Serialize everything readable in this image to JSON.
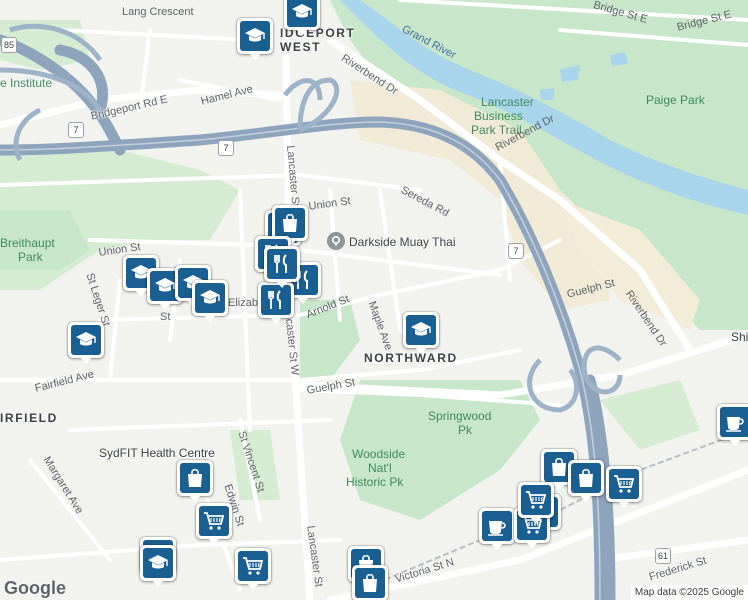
{
  "map": {
    "attribution": "Map data ©2025 Google",
    "logo": "Google",
    "colors": {
      "background": "#f2f2ee",
      "park": "#c8e6c9",
      "water": "#a8d4ec",
      "highway": "#8ea4bd",
      "road": "#ffffff",
      "sand": "#f1ead7",
      "poi_marker": "#1a5f91"
    }
  },
  "labels": {
    "lang_crescent": "Lang Crescent",
    "bridgeport_west_a": "IDGEPORT",
    "bridgeport_west_b": "WEST",
    "institute": "e Institute",
    "bridgeport_rd_e": "Bridgeport Rd E",
    "hamel_ave": "Hamel Ave",
    "riverbend_dr_1": "Riverbend Dr",
    "grand_river": "Grand River",
    "bridge_st_e_1": "Bridge St E",
    "bridge_st_e_2": "Bridge St E",
    "paige_park": "Paige Park",
    "lancaster_park_a": "Lancaster",
    "lancaster_park_b": "Business",
    "lancaster_park_c": "Park Trail",
    "riverbend_dr_2": "Riverbend Dr",
    "riverbend_dr_3": "Riverbend Dr",
    "lancaster_st_w_1": "Lancaster St W",
    "union_st_1": "Union St",
    "sereda_rd": "Sereda Rd",
    "darkside": "Darkside Muay Thai",
    "breithaupt_a": "Breithaupt",
    "breithaupt_b": "Park",
    "union_st_2": "Union St",
    "st_leger": "St Leger St",
    "elizabeth": "Elizabeth",
    "arnold_st": "Arnold St",
    "maple_ave": "Maple Ave",
    "lancaster_st_w_2": "Lancaster St W",
    "guelph_st_1": "Guelph St",
    "northward": "NORTHWARD",
    "shirley": "Shi",
    "fairfield_ave": "Fairfield Ave",
    "fairfield": "IRFIELD",
    "guelph_st_2": "Guelph St",
    "springwood_a": "Springwood",
    "springwood_b": "Pk",
    "sydfit": "SydFIT Health Centre",
    "woodside_a": "Woodside",
    "woodside_b": "Nat'l",
    "woodside_c": "Historic Pk",
    "st_vincent": "St Vincent St",
    "margaret_ave": "Margaret Ave",
    "edwin_st": "Edwin St",
    "lancaster_st_3": "Lancaster St",
    "victoria_st_n": "Victoria St N",
    "frederick_st": "Frederick St",
    "st_short": "St"
  },
  "shields": {
    "hwy85": "85",
    "hwy7a": "7",
    "hwy7b": "7",
    "hwy7c": "7",
    "hwy61": "61"
  },
  "pois": [
    {
      "type": "school",
      "name": "school-marker"
    },
    {
      "type": "school",
      "name": "school-marker"
    },
    {
      "type": "school",
      "name": "school-marker"
    },
    {
      "type": "shopping",
      "name": "shopping-marker"
    },
    {
      "type": "shopping",
      "name": "shopping-marker"
    },
    {
      "type": "restaurant",
      "name": "restaurant-marker"
    },
    {
      "type": "restaurant",
      "name": "restaurant-marker"
    },
    {
      "type": "restaurant",
      "name": "restaurant-marker"
    },
    {
      "type": "school",
      "name": "school-marker"
    },
    {
      "type": "school",
      "name": "school-marker"
    },
    {
      "type": "school",
      "name": "school-marker"
    },
    {
      "type": "school",
      "name": "school-marker"
    },
    {
      "type": "restaurant",
      "name": "restaurant-marker"
    },
    {
      "type": "school",
      "name": "school-marker"
    },
    {
      "type": "school",
      "name": "school-marker"
    },
    {
      "type": "cafe",
      "name": "cafe-marker"
    },
    {
      "type": "shopping",
      "name": "shopping-marker"
    },
    {
      "type": "shopping",
      "name": "shopping-marker"
    },
    {
      "type": "grocery",
      "name": "grocery-marker"
    },
    {
      "type": "grocery",
      "name": "grocery-marker"
    },
    {
      "type": "grocery",
      "name": "grocery-marker"
    },
    {
      "type": "grocery",
      "name": "grocery-marker"
    },
    {
      "type": "shopping",
      "name": "shopping-marker"
    },
    {
      "type": "cafe",
      "name": "cafe-marker"
    },
    {
      "type": "grocery",
      "name": "grocery-marker"
    },
    {
      "type": "school",
      "name": "school-marker"
    },
    {
      "type": "grocery",
      "name": "grocery-marker"
    },
    {
      "type": "shopping",
      "name": "shopping-marker"
    },
    {
      "type": "shopping",
      "name": "shopping-marker"
    }
  ]
}
